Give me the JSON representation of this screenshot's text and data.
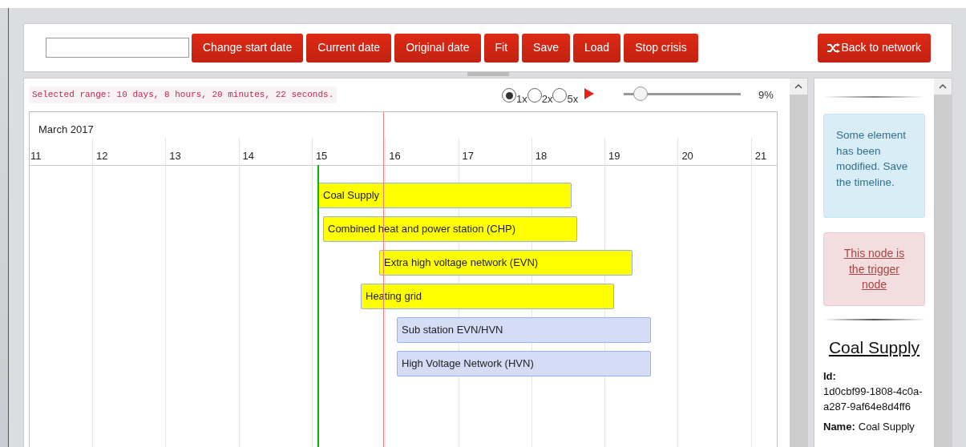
{
  "toolbar": {
    "buttons": [
      {
        "label": "Change start date"
      },
      {
        "label": "Current date"
      },
      {
        "label": "Original date"
      },
      {
        "label": "Fit"
      },
      {
        "label": "Save"
      },
      {
        "label": "Load"
      },
      {
        "label": "Stop crisis"
      }
    ],
    "back_button": {
      "label": "Back to network"
    }
  },
  "timeline": {
    "selected_range": "Selected range: 10 days, 8 hours, 20 minutes, 22 seconds.",
    "speeds": [
      {
        "label": "1x",
        "selected": true
      },
      {
        "label": "2x",
        "selected": false
      },
      {
        "label": "5x",
        "selected": false
      }
    ],
    "slider": {
      "level": 0.09
    },
    "slider_reading": "9%",
    "month": "March 2017",
    "days": [
      "11",
      "12",
      "13",
      "14",
      "15",
      "16",
      "17",
      "18",
      "19",
      "20",
      "21"
    ],
    "items": [
      {
        "label": "Coal Supply",
        "color": "#ffff00"
      },
      {
        "label": "Combined heat and power station (CHP)",
        "color": "#ffff00"
      },
      {
        "label": "Extra high voltage network (EVN)",
        "color": "#ffff00"
      },
      {
        "label": "Heating grid",
        "color": "#ffff00"
      },
      {
        "label": "Sub station EVN/HVN",
        "color": "#d5ddf6"
      },
      {
        "label": "High Voltage Network (HVN)",
        "color": "#d5ddf6"
      }
    ]
  },
  "side_panel": {
    "info_alert": "Some element has been modified. Save the timeline.",
    "trigger_alert": "This node is the trigger node",
    "node_title": "Coal Supply",
    "id_field": {
      "label": "Id:",
      "value": "1d0cbf99-1808-4c0a-a287-9af64e8d4ff6"
    },
    "name_field": {
      "label": "Name:",
      "value": "Coal Supply"
    }
  }
}
